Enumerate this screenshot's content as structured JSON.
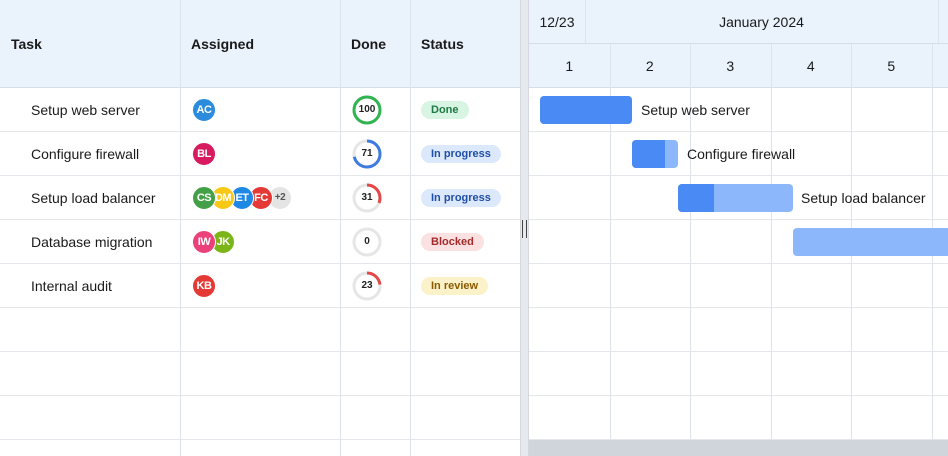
{
  "grid": {
    "columns": [
      "Task",
      "Assigned",
      "Done",
      "Status"
    ],
    "rows": [
      {
        "task": "Setup web server",
        "avatars": [
          {
            "initials": "AC",
            "color": "#2b8bdc"
          }
        ],
        "more": "",
        "done": "100",
        "done_pct": 100,
        "status": "Done",
        "status_bg": "#d8f4e2",
        "status_fg": "#1e7a46"
      },
      {
        "task": "Configure firewall",
        "avatars": [
          {
            "initials": "BL",
            "color": "#d81b60"
          }
        ],
        "more": "",
        "done": "71",
        "done_pct": 71,
        "status": "In progress",
        "status_bg": "#dce8fb",
        "status_fg": "#1f4fa8"
      },
      {
        "task": "Setup load balancer",
        "avatars": [
          {
            "initials": "CS",
            "color": "#43a047"
          },
          {
            "initials": "DM",
            "color": "#f9c816"
          },
          {
            "initials": "ET",
            "color": "#1e88e5"
          },
          {
            "initials": "FC",
            "color": "#e53935"
          }
        ],
        "more": "+2",
        "done": "31",
        "done_pct": 31,
        "status": "In progress",
        "status_bg": "#dce8fb",
        "status_fg": "#1f4fa8"
      },
      {
        "task": "Database migration",
        "avatars": [
          {
            "initials": "IW",
            "color": "#ec407a"
          },
          {
            "initials": "JK",
            "color": "#7cb518"
          }
        ],
        "more": "",
        "done": "0",
        "done_pct": 0,
        "status": "Blocked",
        "status_bg": "#fbe1e1",
        "status_fg": "#a52a2a"
      },
      {
        "task": "Internal audit",
        "avatars": [
          {
            "initials": "KB",
            "color": "#e53935"
          }
        ],
        "more": "",
        "done": "23",
        "done_pct": 23,
        "status": "In review",
        "status_bg": "#fcf2c9",
        "status_fg": "#8a5a00"
      }
    ]
  },
  "gantt": {
    "prev_period": "12/23",
    "month": "January 2024",
    "days": [
      "1",
      "2",
      "3",
      "4",
      "5"
    ],
    "bars": [
      {
        "label": "Setup web server",
        "progress": 100
      },
      {
        "label": "Configure firewall",
        "progress": 71
      },
      {
        "label": "Setup load balancer",
        "progress": 31
      },
      {
        "label": "",
        "progress": 0
      }
    ]
  },
  "colors": {
    "ring_done": "#2fb44f",
    "ring_progress": "#3d7be0",
    "ring_low": "#e34848",
    "ring_track": "#e6e6e6",
    "bar_fill": "#4a8af4",
    "bar_bg": "#8cb8fb"
  }
}
